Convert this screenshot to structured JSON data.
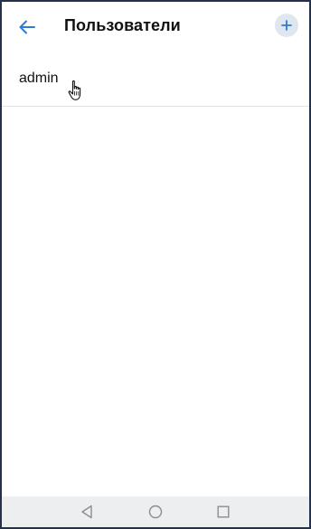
{
  "header": {
    "title": "Пользователи",
    "back_icon": "arrow-left-icon",
    "add_icon": "plus-icon"
  },
  "users": [
    {
      "name": "admin"
    }
  ],
  "system_nav": {
    "back_icon": "triangle-back-icon",
    "home_icon": "circle-home-icon",
    "recents_icon": "square-recents-icon"
  },
  "colors": {
    "accent": "#2e7bd6",
    "frame_border": "#23324a",
    "add_button_bg": "#dfe6ee",
    "divider": "#e2e2e2",
    "navbar_bg": "#eceef0",
    "nav_icon": "#8a8d91"
  }
}
